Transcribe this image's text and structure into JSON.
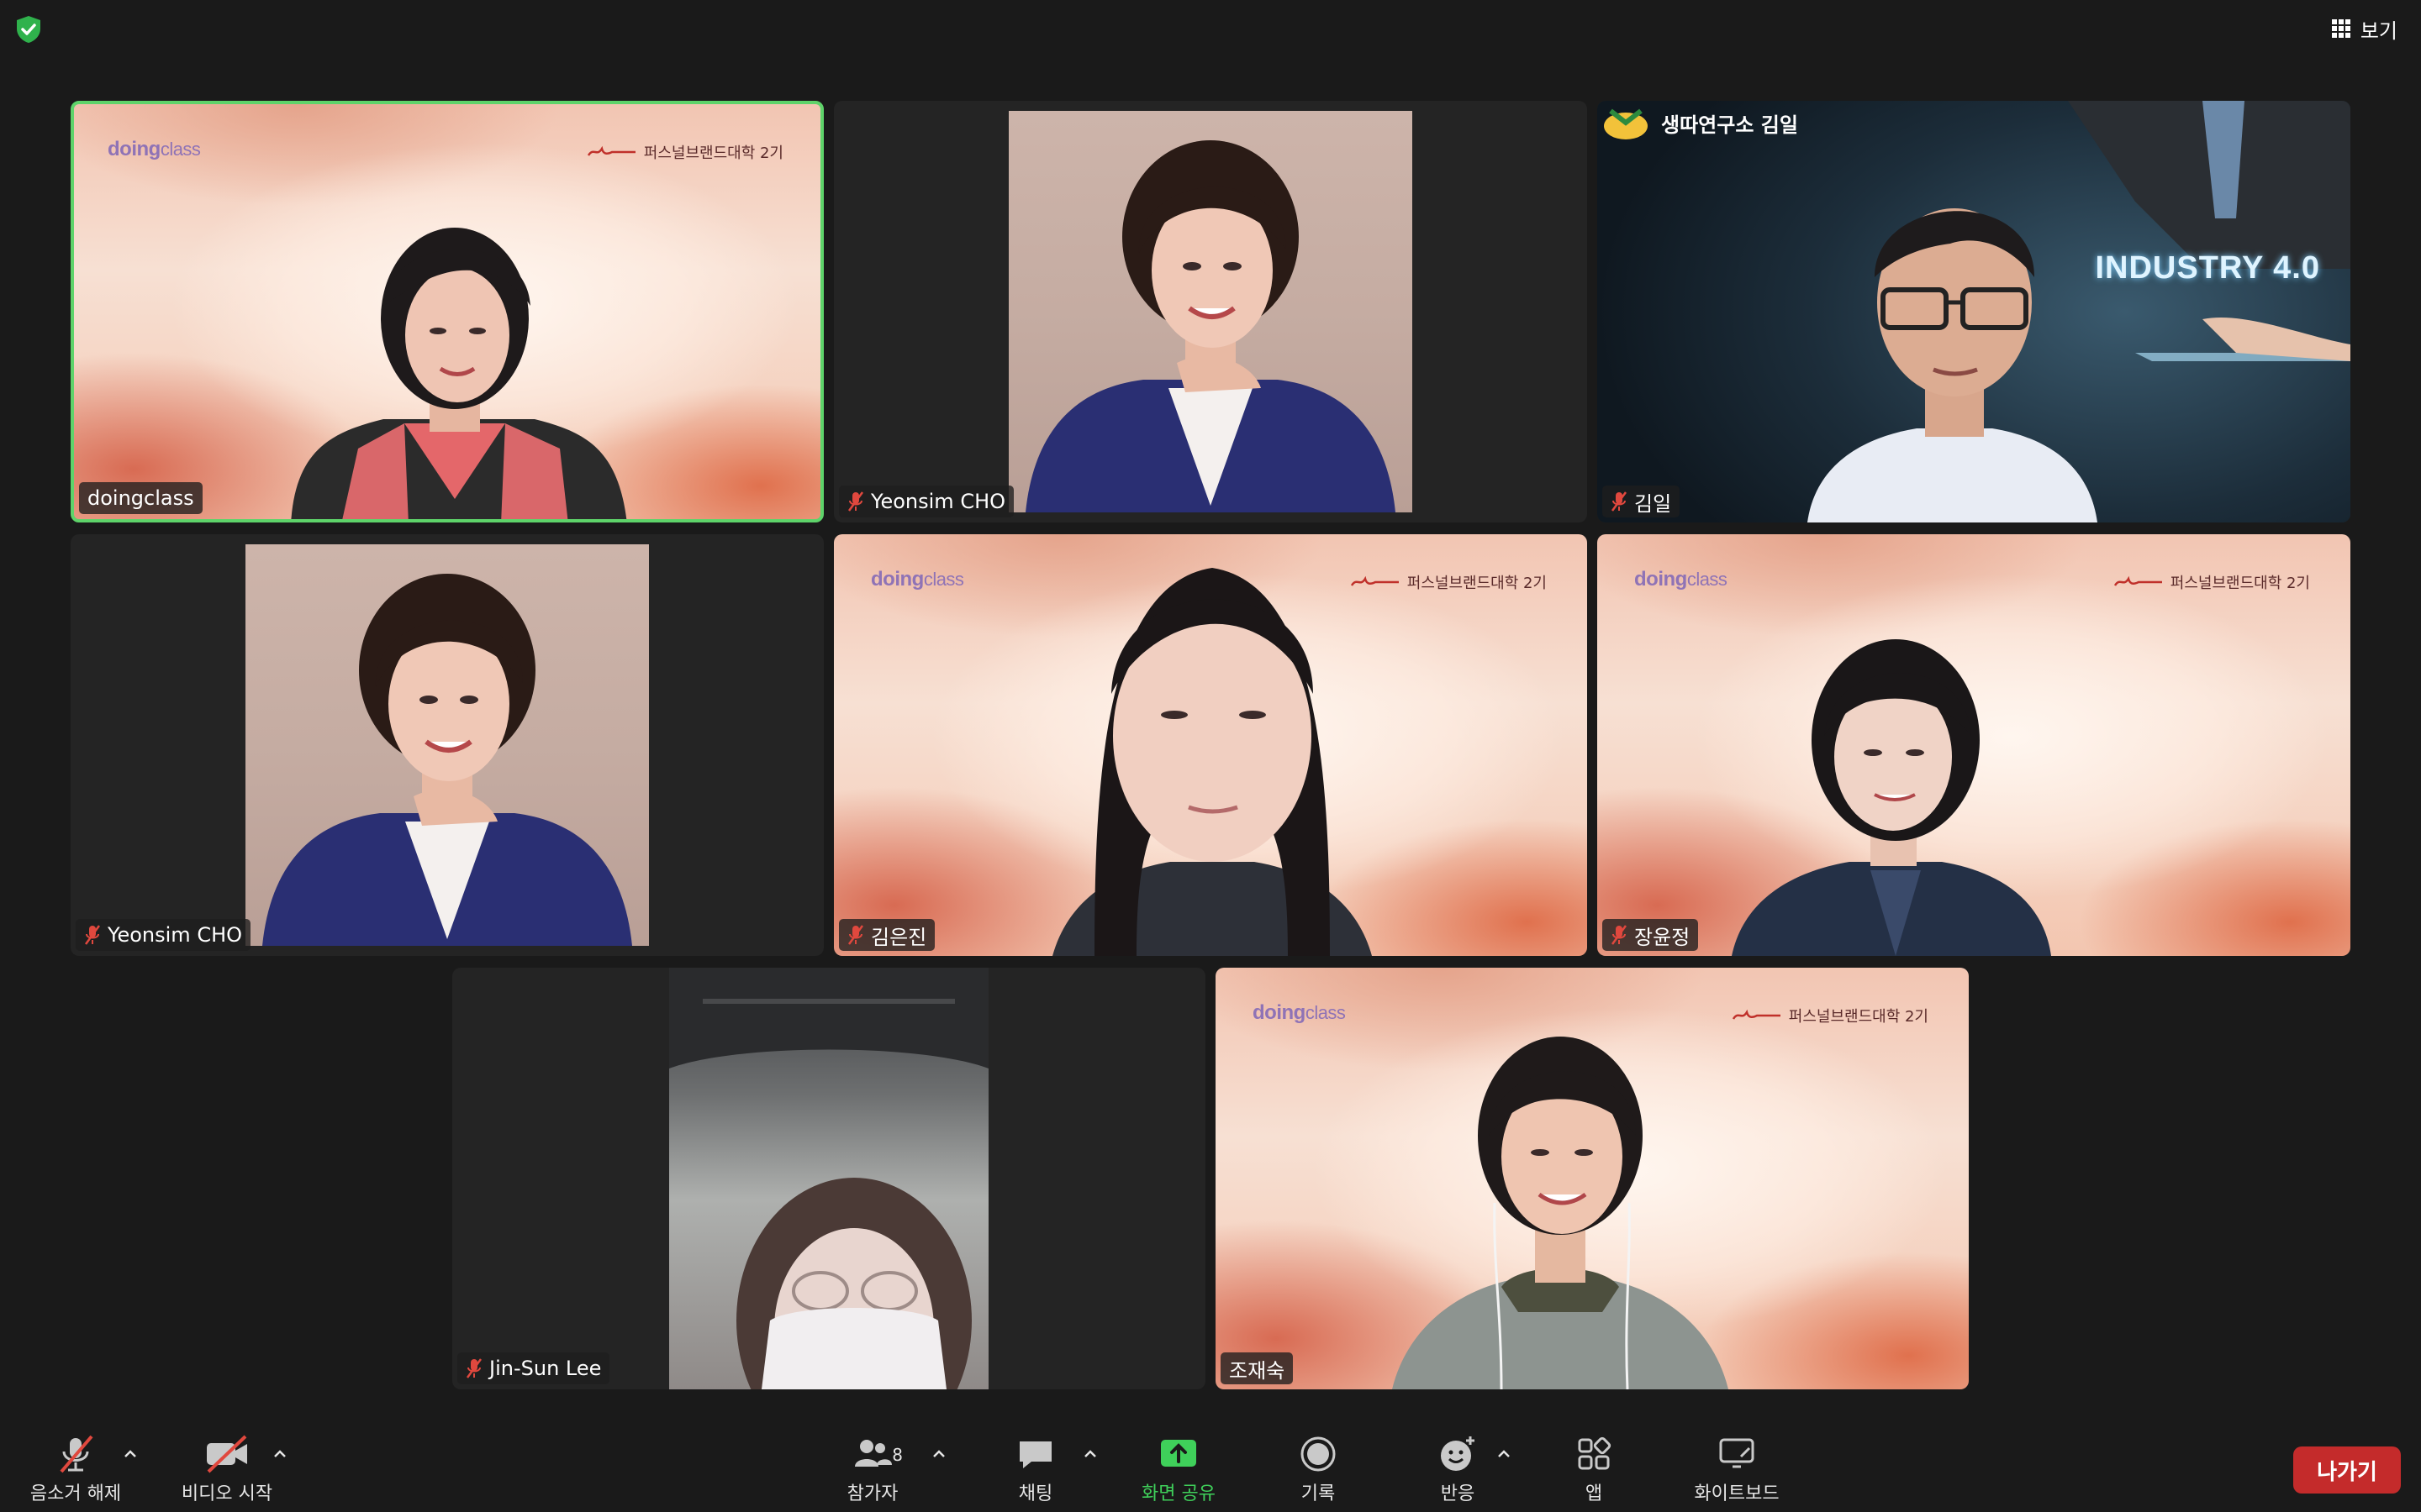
{
  "top": {
    "view_label": "보기"
  },
  "tiles": [
    {
      "name": "doingclass",
      "muted": false,
      "brand": "doing",
      "brand_thin": "class",
      "program": "퍼스널브랜드대학 2기"
    },
    {
      "name": "Yeonsim CHO",
      "muted": true
    },
    {
      "name": "김일",
      "muted": true,
      "logo_text": "생따연구소 김일",
      "banner": "INDUSTRY 4.0"
    },
    {
      "name": "Yeonsim CHO",
      "muted": true
    },
    {
      "name": "김은진",
      "muted": true,
      "brand": "doing",
      "brand_thin": "class",
      "program": "퍼스널브랜드대학 2기"
    },
    {
      "name": "장윤정",
      "muted": true,
      "brand": "doing",
      "brand_thin": "class",
      "program": "퍼스널브랜드대학 2기"
    },
    {
      "name": "Jin-Sun Lee",
      "muted": true
    },
    {
      "name": "조재숙",
      "muted": false,
      "brand": "doing",
      "brand_thin": "class",
      "program": "퍼스널브랜드대학 2기"
    }
  ],
  "toolbar": {
    "unmute": "음소거 해제",
    "start_video": "비디오 시작",
    "participants": "참가자",
    "participants_count": "8",
    "chat": "채팅",
    "share_screen": "화면 공유",
    "record": "기록",
    "reactions": "반응",
    "apps": "앱",
    "whiteboard": "화이트보드",
    "leave": "나가기"
  },
  "colors": {
    "background": "#1a1a1a",
    "tile": "#242424",
    "active_border": "#5ed36a",
    "leave": "#c42b2b",
    "share_green": "#3fd05a",
    "mute_red": "#e0483e"
  }
}
